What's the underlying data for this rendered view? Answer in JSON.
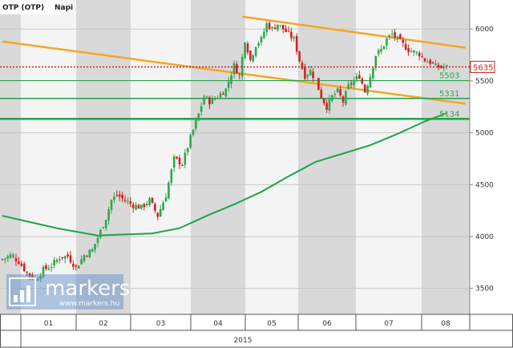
{
  "header": {
    "title": "OTP (OTP)",
    "period": "Napi"
  },
  "watermark": {
    "brand": "markers",
    "url": "www.markers.hu"
  },
  "colors": {
    "up_candle": "#2ea84a",
    "down_candle": "#d42020",
    "trend_line": "#f5a623",
    "moving_average": "#1fa34a",
    "level_line": "#1fa34a",
    "last_price": "#d42020",
    "shade": "#d9d9d9",
    "grid": "#c8c8c8"
  },
  "chart_data": {
    "type": "candlestick",
    "title": "OTP (OTP)  Napi",
    "year_label": "2015",
    "x_months": [
      "01",
      "02",
      "03",
      "04",
      "05",
      "06",
      "07",
      "08"
    ],
    "ylim": [
      3250,
      6280
    ],
    "y_ticks": [
      3500,
      4000,
      4500,
      5000,
      5500,
      6000
    ],
    "last_price": 5635,
    "levels": [
      5503,
      5331,
      5134
    ],
    "grid": true,
    "price_path": [
      [
        0,
        3780
      ],
      [
        3,
        3820
      ],
      [
        6,
        3760
      ],
      [
        9,
        3650
      ],
      [
        12,
        3580
      ],
      [
        15,
        3680
      ],
      [
        18,
        3720
      ],
      [
        21,
        3800
      ],
      [
        24,
        3810
      ],
      [
        27,
        3700
      ],
      [
        30,
        3820
      ],
      [
        33,
        3870
      ],
      [
        36,
        4050
      ],
      [
        38,
        4180
      ],
      [
        40,
        4350
      ],
      [
        42,
        4400
      ],
      [
        45,
        4350
      ],
      [
        48,
        4300
      ],
      [
        51,
        4280
      ],
      [
        54,
        4350
      ],
      [
        57,
        4200
      ],
      [
        60,
        4400
      ],
      [
        63,
        4750
      ],
      [
        66,
        4700
      ],
      [
        69,
        4950
      ],
      [
        72,
        5180
      ],
      [
        74,
        5350
      ],
      [
        76,
        5300
      ],
      [
        79,
        5350
      ],
      [
        82,
        5420
      ],
      [
        85,
        5650
      ],
      [
        87,
        5550
      ],
      [
        89,
        5900
      ],
      [
        91,
        5700
      ],
      [
        93,
        5850
      ],
      [
        95,
        5900
      ],
      [
        97,
        6050
      ],
      [
        99,
        6000
      ],
      [
        101,
        6050
      ],
      [
        103,
        6000
      ],
      [
        105,
        5950
      ],
      [
        107,
        5900
      ],
      [
        109,
        5700
      ],
      [
        111,
        5550
      ],
      [
        113,
        5600
      ],
      [
        115,
        5500
      ],
      [
        117,
        5350
      ],
      [
        119,
        5250
      ],
      [
        121,
        5350
      ],
      [
        123,
        5400
      ],
      [
        125,
        5300
      ],
      [
        127,
        5450
      ],
      [
        129,
        5500
      ],
      [
        131,
        5550
      ],
      [
        133,
        5400
      ],
      [
        135,
        5550
      ],
      [
        137,
        5750
      ],
      [
        139,
        5800
      ],
      [
        141,
        5900
      ],
      [
        143,
        5950
      ],
      [
        145,
        5900
      ],
      [
        147,
        5850
      ],
      [
        149,
        5800
      ],
      [
        151,
        5780
      ],
      [
        153,
        5760
      ],
      [
        155,
        5700
      ],
      [
        157,
        5680
      ],
      [
        159,
        5640
      ],
      [
        161,
        5630
      ],
      [
        163,
        5635
      ]
    ],
    "moving_average": [
      [
        0,
        4200
      ],
      [
        20,
        4080
      ],
      [
        35,
        4010
      ],
      [
        45,
        4020
      ],
      [
        55,
        4030
      ],
      [
        65,
        4080
      ],
      [
        75,
        4200
      ],
      [
        85,
        4310
      ],
      [
        95,
        4430
      ],
      [
        105,
        4580
      ],
      [
        115,
        4720
      ],
      [
        125,
        4800
      ],
      [
        135,
        4880
      ],
      [
        145,
        4990
      ],
      [
        155,
        5110
      ],
      [
        163,
        5190
      ]
    ],
    "trend_lines": [
      {
        "from": [
          0,
          5880
        ],
        "to": [
          170,
          5280
        ]
      },
      {
        "from": [
          88,
          6120
        ],
        "to": [
          170,
          5820
        ]
      }
    ]
  }
}
